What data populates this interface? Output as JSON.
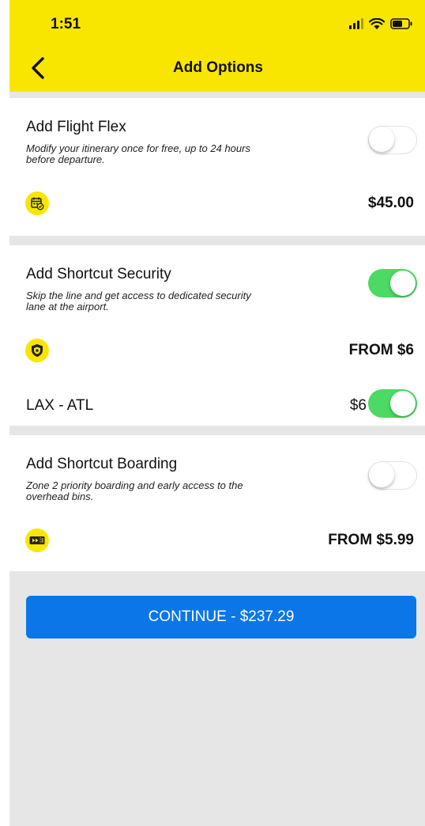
{
  "status_bar": {
    "time": "1:51",
    "icons": [
      "signal-icon",
      "wifi-icon",
      "battery-icon"
    ]
  },
  "header": {
    "back_icon": "chevron-left-icon",
    "title": "Add Options",
    "background_color": "#f9e600"
  },
  "options": [
    {
      "title": "Add Flight Flex",
      "description": "Modify your itinerary once for free, up to 24 hours before departure.",
      "toggle_on": false,
      "icon": "calendar-icon",
      "price": "$45.00"
    },
    {
      "title": "Add Shortcut Security",
      "description": "Skip the line and get access to dedicated security lane at the airport.",
      "toggle_on": true,
      "icon": "shield-icon",
      "price": "FROM $6",
      "routes": [
        {
          "label": "LAX - ATL",
          "price": "$6",
          "toggle_on": true
        }
      ]
    },
    {
      "title": "Add Shortcut Boarding",
      "description": "Zone 2 priority boarding and early access to the overhead bins.",
      "toggle_on": false,
      "icon": "boarding-pass-icon",
      "price": "FROM $5.99"
    }
  ],
  "continue_button": {
    "label": "CONTINUE - $237.29",
    "color": "#0a76e8"
  },
  "colors": {
    "toggle_on": "#4cd964",
    "page_background": "#e6e6e6"
  }
}
